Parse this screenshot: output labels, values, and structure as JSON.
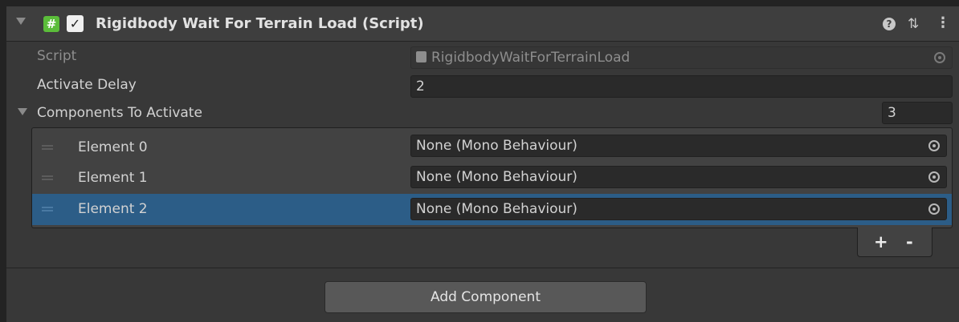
{
  "header": {
    "title": "Rigidbody Wait For Terrain Load (Script)",
    "enabled": true,
    "script_icon": "hash-icon",
    "help_icon": "help-icon",
    "presets_icon": "presets-icon",
    "menu_icon": "kebab-menu-icon"
  },
  "fields": {
    "script_label": "Script",
    "script_value": "RigidbodyWaitForTerrainLoad",
    "delay_label": "Activate Delay",
    "delay_value": "2",
    "components_label": "Components To Activate",
    "components_count": "3"
  },
  "list": {
    "items": [
      {
        "label": "Element 0",
        "value": "None (Mono Behaviour)",
        "selected": false
      },
      {
        "label": "Element 1",
        "value": "None (Mono Behaviour)",
        "selected": false
      },
      {
        "label": "Element 2",
        "value": "None (Mono Behaviour)",
        "selected": true
      }
    ],
    "add_label": "+",
    "remove_label": "-"
  },
  "add_component_label": "Add Component",
  "colors": {
    "background": "#383838",
    "header": "#3e3e3e",
    "field": "#2a2a2a",
    "selection": "#2c5d87",
    "script_icon": "#5bbd3a"
  }
}
